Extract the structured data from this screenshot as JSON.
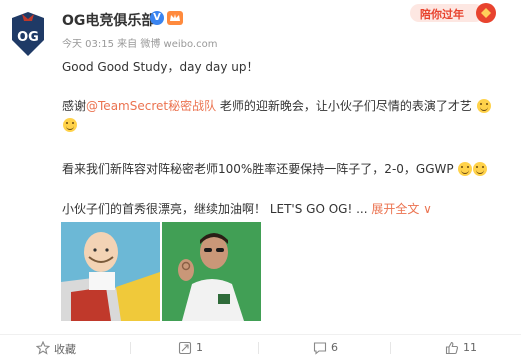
{
  "post": {
    "username": "OG电竞俱乐部",
    "verified_badge": "V",
    "meta": "今天 03:15 来自 微博 weibo.com",
    "festive_label": "陪你过年",
    "lines": {
      "l1": "Good Good Study，day day up！",
      "l2_prefix": "感谢",
      "l2_mention": "@TeamSecret秘密战队",
      "l2_suffix": " 老师的迎新晚会，让小伙子们尽情的表演了才艺",
      "l4": "看来我们新阵容对阵秘密老师100%胜率还要保持一阵子了，2-0，GGWP",
      "l5_text": "小伙子们的首秀很漂亮，继续加油啊！ LET'S GO OG! ...",
      "l5_expand": "展开全文 ∨"
    }
  },
  "actions": {
    "favorite_label": "收藏",
    "repost_count": "1",
    "comment_count": "6",
    "like_count": "11"
  },
  "icons": {
    "avatar": "og-logo-icon",
    "member": "member-crown-icon",
    "favorite": "star-icon",
    "repost": "repost-icon",
    "comment": "comment-icon",
    "like": "thumbs-up-icon"
  },
  "colors": {
    "mention": "#eb7350",
    "verified": "#3a84f0",
    "festive": "#e8432e"
  }
}
